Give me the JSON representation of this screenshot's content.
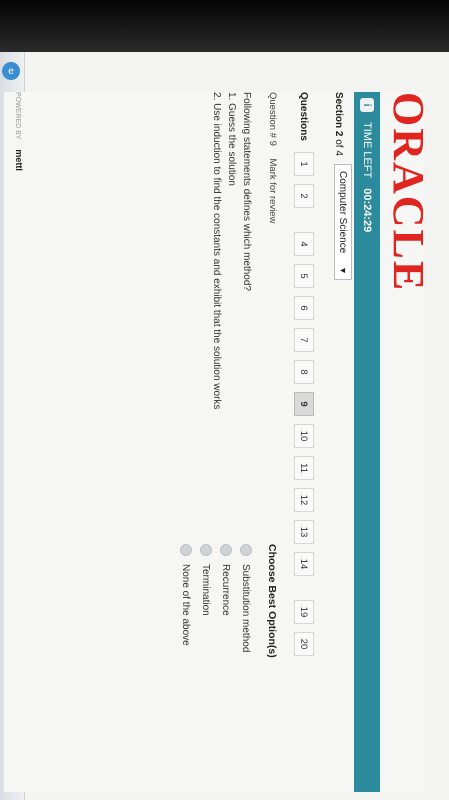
{
  "brand": {
    "logo": "ORACLE"
  },
  "timer": {
    "label": "TIME LEFT",
    "value": "00:24:29"
  },
  "section": {
    "prefix": "Section",
    "current": "2",
    "of_text": "of 4"
  },
  "subject_select": {
    "value": "Computer Science"
  },
  "questions_label": "Questions",
  "question_numbers": [
    "1",
    "2",
    "4",
    "5",
    "6",
    "7",
    "8",
    "9",
    "10",
    "11",
    "12",
    "13",
    "14",
    "19",
    "20"
  ],
  "question": {
    "number_label": "Question # 9",
    "mark_review": "Mark for review",
    "prompt": "Following statements defines which method?",
    "line1": "1. Guess the solution",
    "line2": "2. Use induction to find the constants and exhibit that the solution works"
  },
  "options_title": "Choose Best Option(s)",
  "options": [
    "Substitution method",
    "Recurrence",
    "Termination",
    "None of the above"
  ],
  "footer": {
    "powered": "POWERED BY",
    "logo": "mettl"
  },
  "colors": {
    "brand_red": "#e02420",
    "timebar_teal": "#2b8a9c"
  }
}
